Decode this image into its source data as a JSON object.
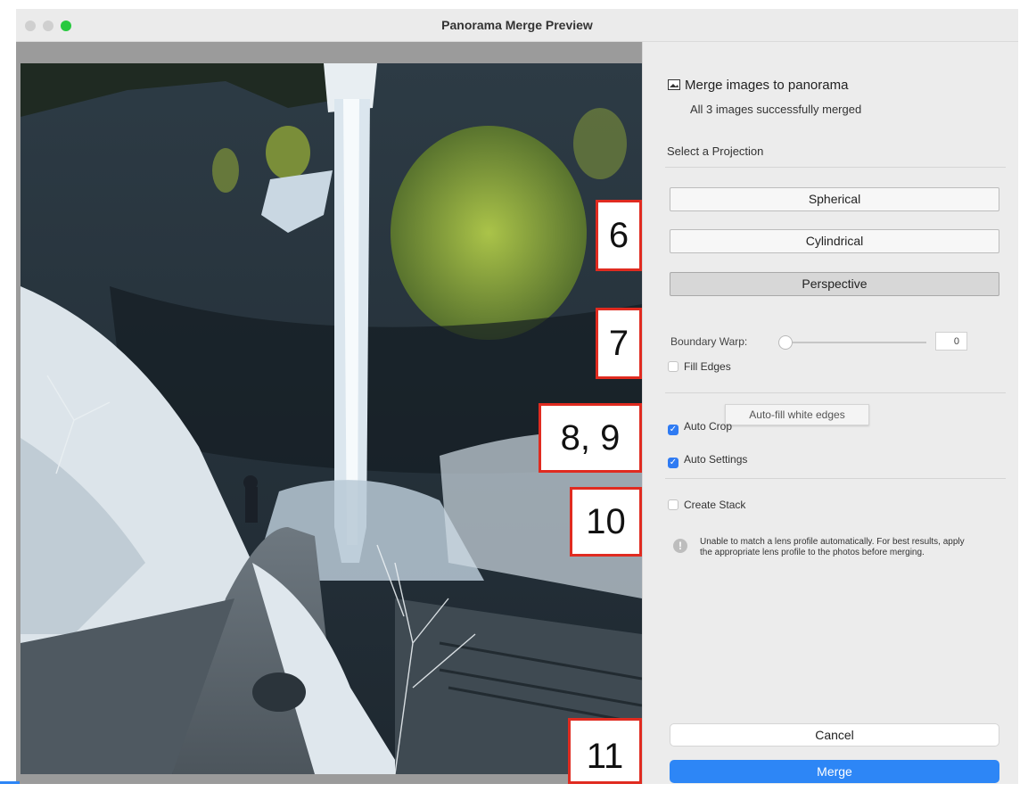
{
  "window": {
    "title": "Panorama Merge Preview"
  },
  "panel": {
    "header": "Merge images to panorama",
    "subheader": "All 3 images successfully merged",
    "projection_label": "Select a Projection",
    "projections": [
      "Spherical",
      "Cylindrical",
      "Perspective"
    ],
    "active_projection": "Perspective",
    "boundary_warp": {
      "label": "Boundary Warp:",
      "value": "0"
    },
    "fill_edges": {
      "label": "Fill Edges",
      "checked": false
    },
    "tooltip": "Auto-fill white edges",
    "auto_crop": {
      "label": "Auto Crop",
      "checked": true
    },
    "auto_settings": {
      "label": "Auto Settings",
      "checked": true
    },
    "create_stack": {
      "label": "Create Stack",
      "checked": false
    },
    "warning": "Unable to match a lens profile automatically. For best results, apply the appropriate lens profile to the photos before merging.",
    "cancel_label": "Cancel",
    "merge_label": "Merge"
  },
  "callouts": [
    "6",
    "7",
    "8, 9",
    "10",
    "11"
  ],
  "colors": {
    "accent": "#2d86f6",
    "callout_border": "#e02b20"
  },
  "icons": {
    "header": "panorama-icon",
    "warning": "info-icon",
    "check": "checkmark-icon"
  }
}
